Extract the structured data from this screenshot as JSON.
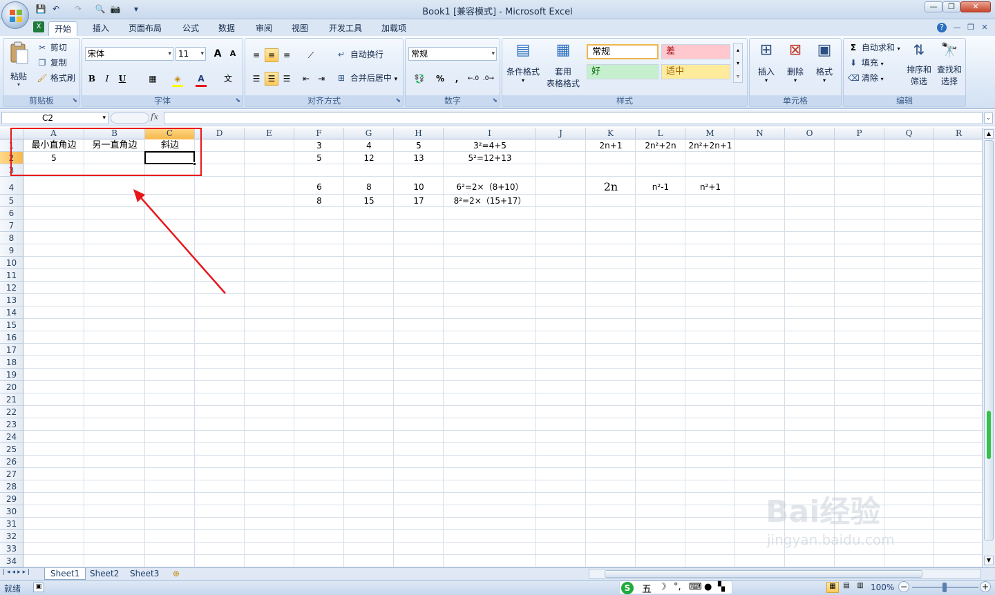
{
  "window": {
    "title": "Book1  [兼容模式] - Microsoft Excel"
  },
  "qat": {
    "save": "💾",
    "undo": "↶",
    "redo": "↷",
    "preview": "🔍",
    "camera": "📷",
    "more": "▾"
  },
  "window_buttons": {
    "minimize": "—",
    "restore": "❐",
    "close": "✕"
  },
  "ribbon_tabs": [
    {
      "label": "开始"
    },
    {
      "label": "插入"
    },
    {
      "label": "页面布局"
    },
    {
      "label": "公式"
    },
    {
      "label": "数据"
    },
    {
      "label": "审阅"
    },
    {
      "label": "视图"
    },
    {
      "label": "开发工具"
    },
    {
      "label": "加载项"
    }
  ],
  "ribbon_right": {
    "help": "?",
    "min": "—",
    "restore": "❐",
    "close": "✕"
  },
  "clipboard": {
    "label": "剪贴板",
    "paste": "粘贴",
    "cut": "剪切",
    "copy": "复制",
    "format_painter": "格式刷"
  },
  "font": {
    "label": "字体",
    "name": "宋体",
    "size": "11",
    "bold": "B",
    "italic": "I",
    "underline": "U",
    "grow": "A",
    "shrink": "A",
    "phonetic": "文"
  },
  "alignment": {
    "label": "对齐方式",
    "wrap": "自动换行",
    "merge": "合并后居中"
  },
  "number": {
    "label": "数字",
    "format": "常规",
    "percent": "%",
    "comma": ","
  },
  "styles": {
    "label": "样式",
    "conditional": "条件格式",
    "table_line1": "套用",
    "table_line2": "表格格式",
    "normal": "常规",
    "bad": "差",
    "good": "好",
    "neutral": "适中"
  },
  "cells": {
    "label": "单元格",
    "insert": "插入",
    "delete": "删除",
    "format": "格式"
  },
  "editing": {
    "label": "编辑",
    "autosum": "自动求和",
    "fill": "填充",
    "clear": "清除",
    "sort_line1": "排序和",
    "sort_line2": "筛选",
    "find_line1": "查找和",
    "find_line2": "选择"
  },
  "formula_bar": {
    "name_box": "C2",
    "fx": "fx",
    "value": ""
  },
  "columns": [
    "A",
    "B",
    "C",
    "D",
    "E",
    "F",
    "G",
    "H",
    "I",
    "J",
    "K",
    "L",
    "M",
    "N",
    "O",
    "P",
    "Q",
    "R"
  ],
  "rows": [
    "1",
    "2",
    "3",
    "4",
    "5",
    "6",
    "7",
    "8",
    "9",
    "10",
    "11",
    "12",
    "13",
    "14",
    "15",
    "16",
    "17",
    "18",
    "19",
    "20",
    "21",
    "22",
    "23",
    "24",
    "25",
    "26",
    "27",
    "28",
    "29",
    "30",
    "31",
    "32",
    "33",
    "34"
  ],
  "cells_data": {
    "A1": "最小直角边",
    "B1": "另一直角边",
    "C1": "斜边",
    "A2": "5",
    "F1": "3",
    "G1": "4",
    "H1": "5",
    "I1": "3²=4+5",
    "K1": "2n+1",
    "L1": "2n²+2n",
    "M1": "2n²+2n+1",
    "F2": "5",
    "G2": "12",
    "H2": "13",
    "I2": "5²=12+13",
    "F4": "6",
    "G4": "8",
    "H4": "10",
    "I4": "6²=2×（8+10）",
    "K4": "2n",
    "L4": "n²-1",
    "M4": "n²+1",
    "F5": "8",
    "G5": "15",
    "H5": "17",
    "I5": "8²=2×（15+17）"
  },
  "sheets": [
    {
      "label": "Sheet1"
    },
    {
      "label": "Sheet2"
    },
    {
      "label": "Sheet3"
    }
  ],
  "status": {
    "ready": "就绪",
    "zoom": "100%",
    "ime": "五",
    "minus": "−",
    "plus": "+"
  },
  "watermark": {
    "line1": "Bai经验",
    "line2": "jingyan.baidu.com"
  },
  "colors": {
    "accent": "#f7b84a",
    "annotation": "#e8161b",
    "ribbon_bg": "#dce8f6"
  }
}
